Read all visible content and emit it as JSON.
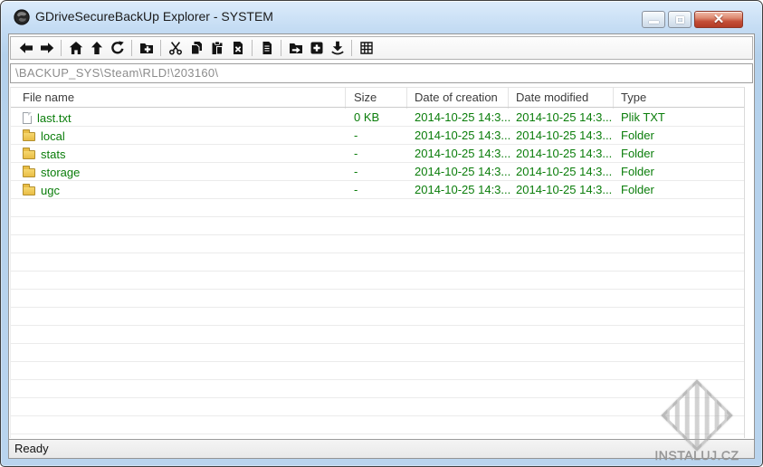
{
  "window": {
    "title": "GDriveSecureBackUp Explorer - SYSTEM",
    "app_icon": "globe-icon",
    "controls": [
      "minimize",
      "maximize",
      "close"
    ]
  },
  "toolbar": {
    "buttons": [
      "back",
      "forward",
      "home",
      "up",
      "refresh",
      "new-folder",
      "cut",
      "copy",
      "paste",
      "delete",
      "properties",
      "move-to-folder",
      "add",
      "download",
      "grid-view"
    ]
  },
  "address_bar": {
    "value": "\\BACKUP_SYS\\Steam\\RLD!\\203160\\"
  },
  "table": {
    "columns": [
      "File name",
      "Size",
      "Date of creation",
      "Date modified",
      "Type"
    ],
    "rows": [
      {
        "icon": "file",
        "name": "last.txt",
        "size": "0 KB",
        "created": "2014-10-25 14:3...",
        "modified": "2014-10-25 14:3...",
        "type": "Plik TXT"
      },
      {
        "icon": "folder",
        "name": "local",
        "size": "-",
        "created": "2014-10-25 14:3...",
        "modified": "2014-10-25 14:3...",
        "type": "Folder"
      },
      {
        "icon": "folder",
        "name": "stats",
        "size": "-",
        "created": "2014-10-25 14:3...",
        "modified": "2014-10-25 14:3...",
        "type": "Folder"
      },
      {
        "icon": "folder",
        "name": "storage",
        "size": "-",
        "created": "2014-10-25 14:3...",
        "modified": "2014-10-25 14:3...",
        "type": "Folder"
      },
      {
        "icon": "folder",
        "name": "ugc",
        "size": "-",
        "created": "2014-10-25 14:3...",
        "modified": "2014-10-25 14:3...",
        "type": "Folder"
      }
    ]
  },
  "status_bar": {
    "text": "Ready"
  },
  "watermark": {
    "text": "INSTALUJ.CZ"
  },
  "colors": {
    "titlebar_blue": "#bdd8f1",
    "close_button_red": "#c24a35",
    "row_text_green": "#0a7d0a",
    "folder_gold": "#e9bd45",
    "toolbar_icon": "#141414"
  }
}
